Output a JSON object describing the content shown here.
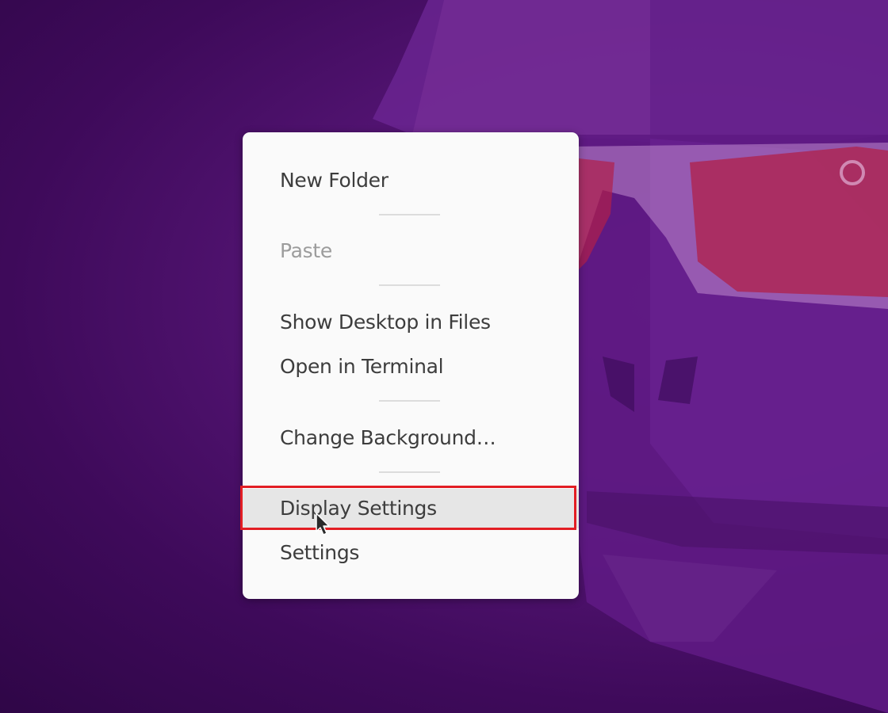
{
  "menu": {
    "items": [
      {
        "label": "New Folder",
        "enabled": true
      },
      {
        "label": "Paste",
        "enabled": false
      },
      {
        "label": "Show Desktop in Files",
        "enabled": true
      },
      {
        "label": "Open in Terminal",
        "enabled": true
      },
      {
        "label": "Change Background…",
        "enabled": true
      },
      {
        "label": "Display Settings",
        "enabled": true,
        "highlighted": true
      },
      {
        "label": "Settings",
        "enabled": true
      }
    ]
  },
  "colors": {
    "wallpaper": "#551575",
    "menu_background": "#fafafa",
    "menu_text": "#3d3d3d",
    "disabled_text": "#9c9c9c",
    "highlight_border": "#e21e24"
  },
  "icons": {
    "cursor": "mouse-pointer-icon",
    "wallpaper_logo": "ubuntu-logo-icon"
  }
}
